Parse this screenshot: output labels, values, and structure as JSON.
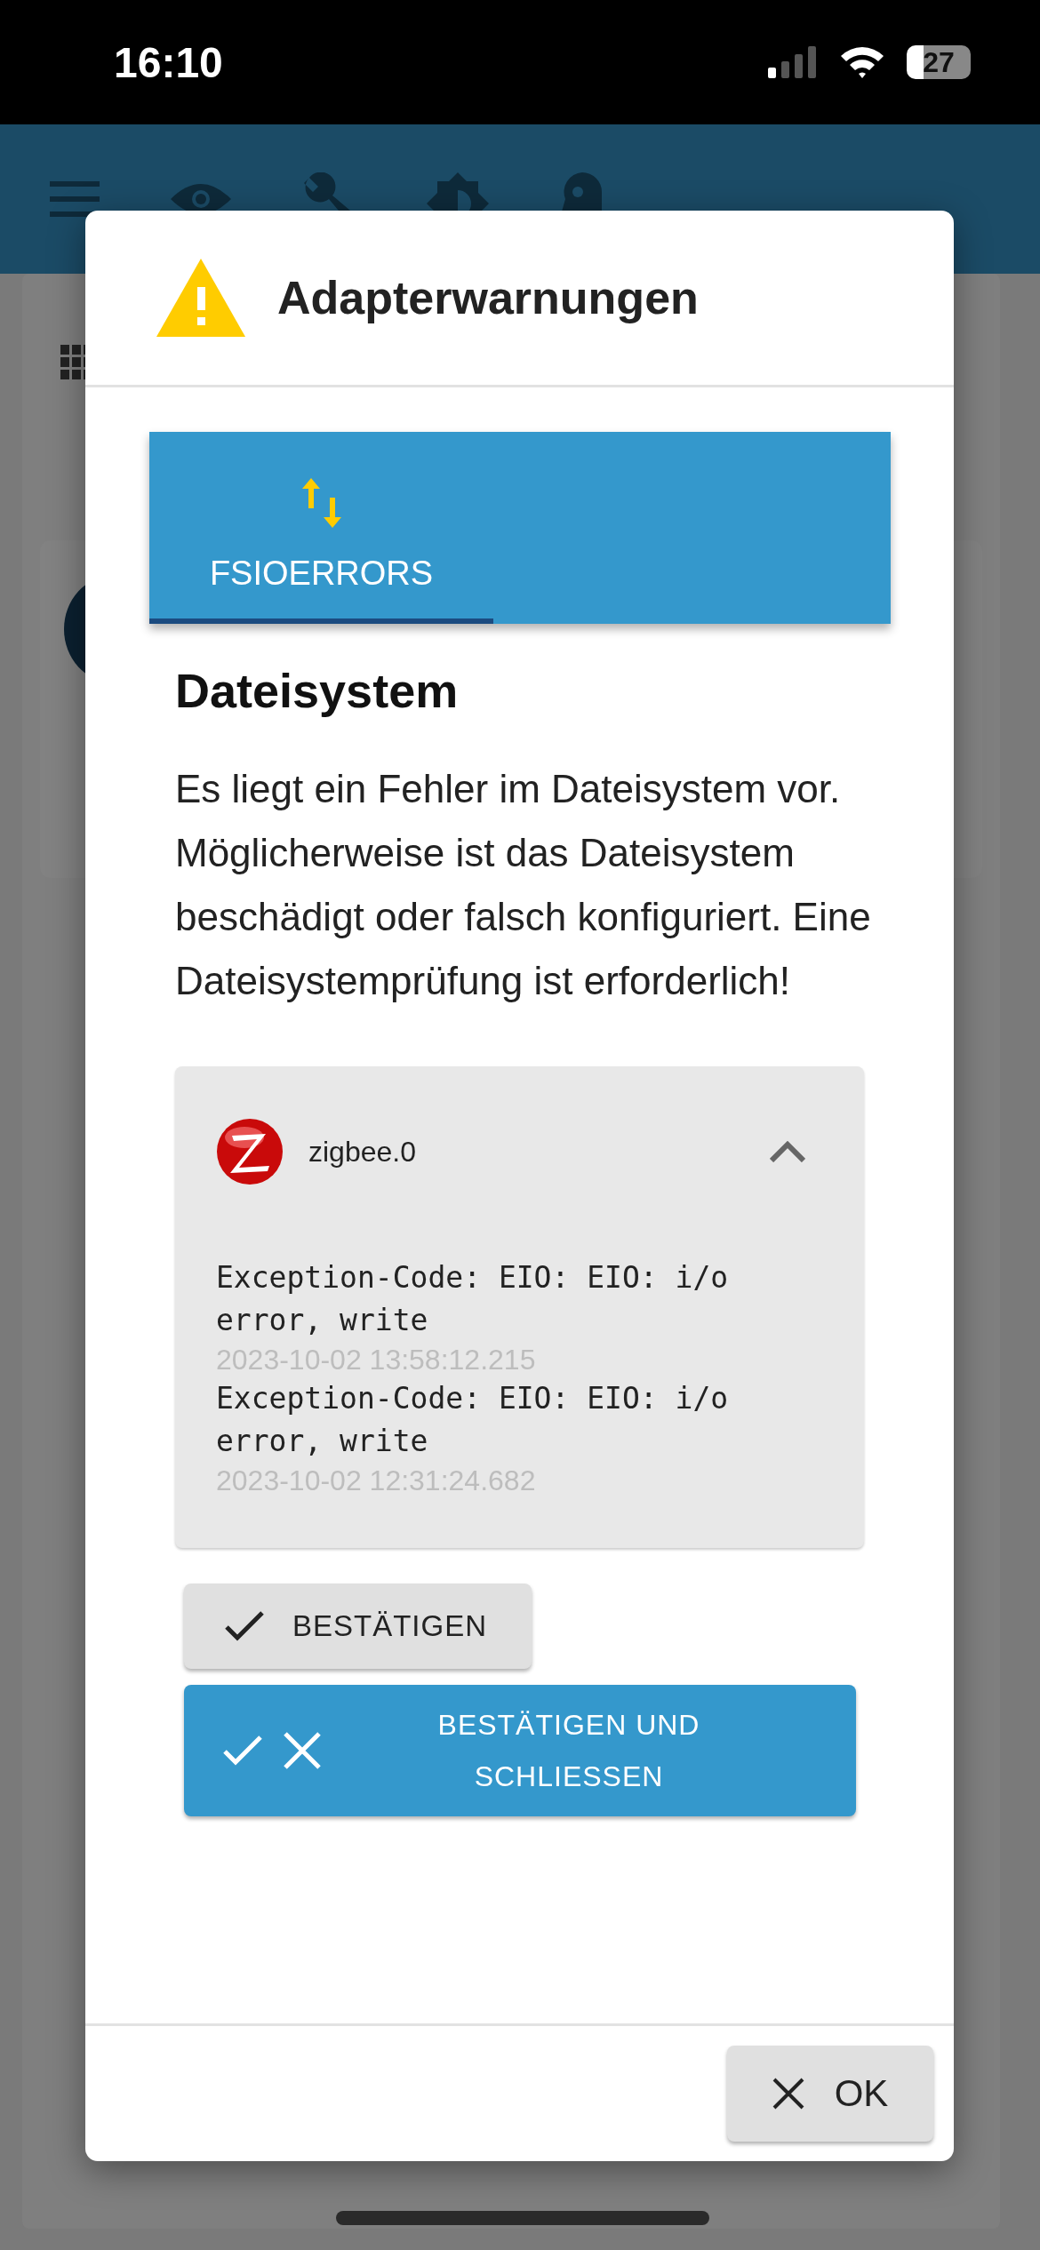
{
  "status_bar": {
    "time": "16:10",
    "battery": "27"
  },
  "dialog": {
    "title": "Adapterwarnungen",
    "tabs": [
      {
        "label": "FSIOERRORS",
        "selected": true
      }
    ],
    "heading": "Dateisystem",
    "message": "Es liegt ein Fehler im Dateisystem vor. Möglicherweise ist das Dateisystem beschädigt oder falsch konfiguriert. Eine Dateisystemprüfung ist erforderlich!",
    "adapter": {
      "name": "zigbee.0",
      "expanded": true,
      "entries": [
        {
          "message": "Exception-Code: EIO: EIO: i/o error, write",
          "time": "2023-10-02 13:58:12.215"
        },
        {
          "message": "Exception-Code: EIO: EIO: i/o error, write",
          "time": "2023-10-02 12:31:24.682"
        }
      ]
    },
    "buttons": [
      {
        "kind": "confirm",
        "label": "BESTÄTIGEN"
      },
      {
        "kind": "confirm_close",
        "label": "BESTÄTIGEN UND SCHLIESSEN"
      }
    ],
    "footer_button": {
      "label": "OK"
    }
  }
}
